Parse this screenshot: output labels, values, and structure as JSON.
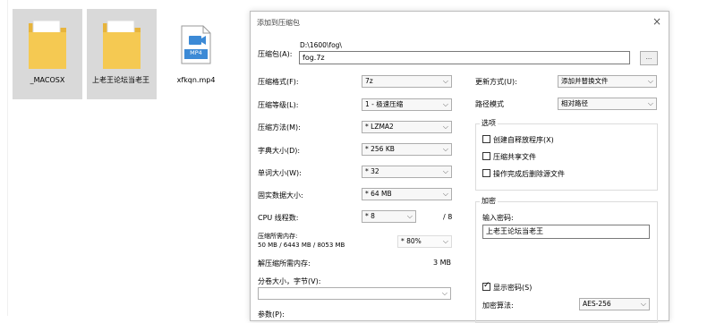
{
  "explorer": {
    "files": [
      {
        "name": "_MACOSX",
        "type": "folder"
      },
      {
        "name": "上老王论坛当老王",
        "type": "folder"
      },
      {
        "name": "xfkqn.mp4",
        "type": "video",
        "badge": "MP4"
      }
    ]
  },
  "dialog": {
    "title": "添加到压缩包",
    "close": "×",
    "archive_label": "压缩包(A):",
    "archive_path": "D:\\1600\\fog\\",
    "archive_name": "fog.7z",
    "browse_label": "...",
    "left_rows": {
      "format_label": "压缩格式(F):",
      "format_value": "7z",
      "level_label": "压缩等级(L):",
      "level_value": "1 - 极速压缩",
      "method_label": "压缩方法(M):",
      "method_value": "* LZMA2",
      "dict_label": "字典大小(D):",
      "dict_value": "* 256 KB",
      "word_label": "单词大小(W):",
      "word_value": "* 32",
      "solid_label": "固实数据大小:",
      "solid_value": "* 64 MB",
      "cpu_label": "CPU 线程数:",
      "cpu_value": "* 8",
      "cpu_total": "/ 8",
      "mem_comp_label": "压缩所需内存:",
      "mem_comp_sub": "50 MB / 6443 MB / 8053 MB",
      "mem_comp_pct": "* 80%",
      "mem_decomp_label": "解压缩所需内存:",
      "mem_decomp_value": "3 MB",
      "split_label": "分卷大小，字节(V):",
      "split_value": "",
      "params_label": "参数(P):"
    },
    "right": {
      "update_label": "更新方式(U):",
      "update_value": "添加并替换文件",
      "path_label": "路径模式",
      "path_value": "相对路径",
      "options_title": "选项",
      "opt_sfx": "创建自释放程序(X)",
      "opt_shared": "压缩共享文件",
      "opt_delete": "操作完成后删除源文件",
      "encrypt_title": "加密",
      "password_label": "输入密码:",
      "password_value": "上老王论坛当老王",
      "show_password": "显示密码(S)",
      "enc_method_label": "加密算法:",
      "enc_method_value": "AES-256"
    }
  },
  "colors": {
    "folder": "#f5c952",
    "folder_dark": "#e7b43c",
    "selection": "#cce8ff",
    "video_icon": "#3c8ad6"
  }
}
